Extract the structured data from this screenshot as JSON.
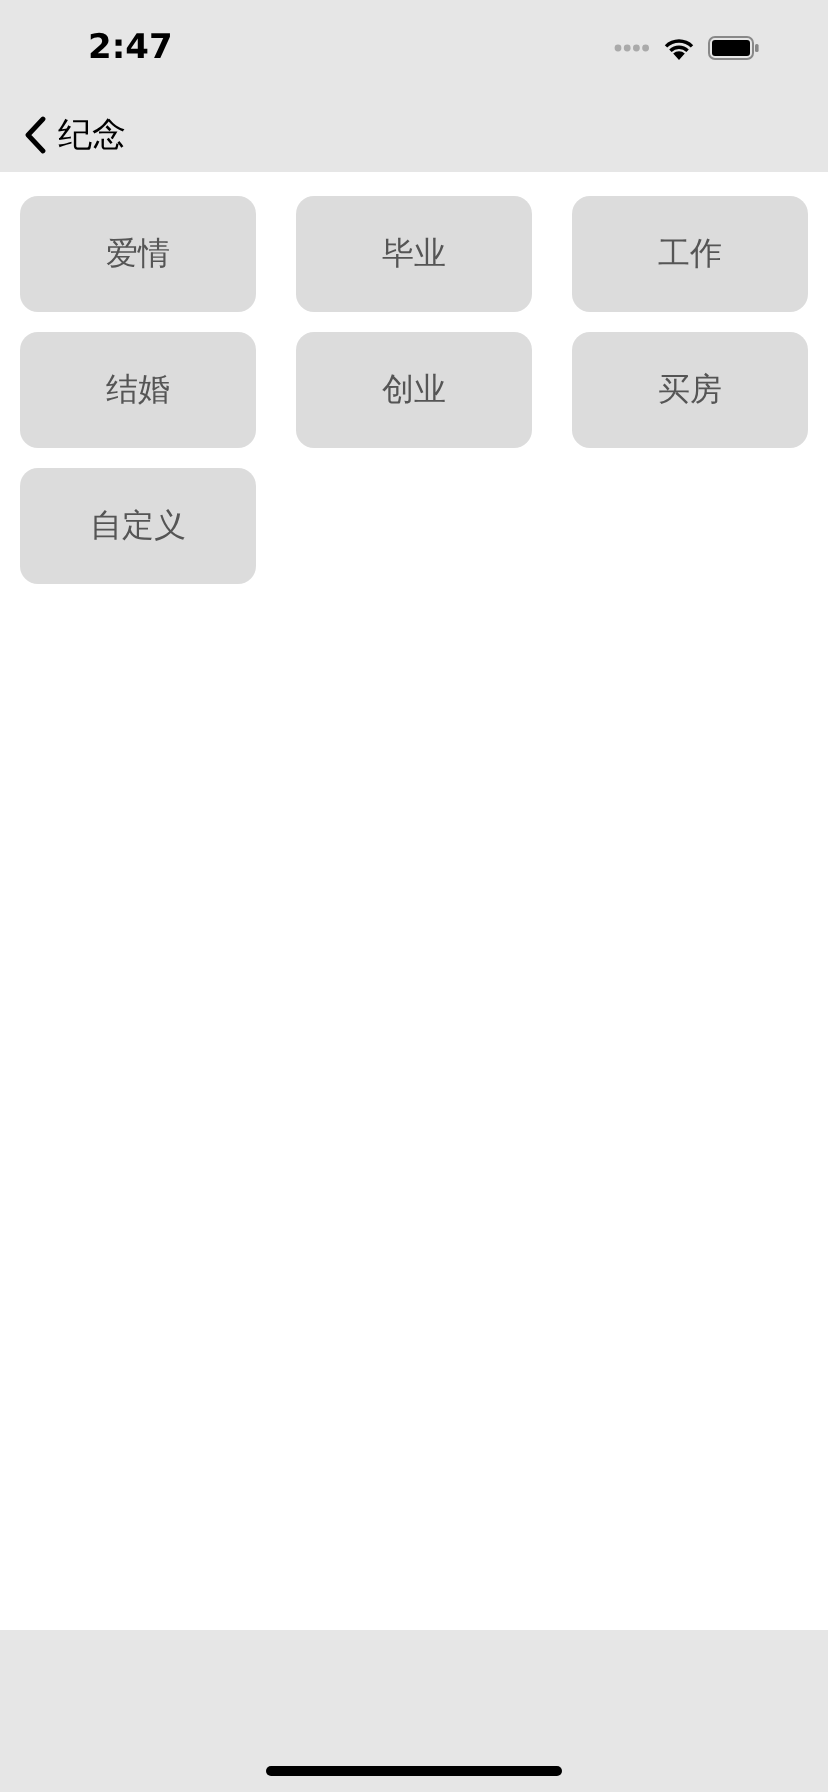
{
  "status_bar": {
    "time": "2:47"
  },
  "nav_bar": {
    "back_label": "纪念"
  },
  "options": [
    {
      "label": "爱情"
    },
    {
      "label": "毕业"
    },
    {
      "label": "工作"
    },
    {
      "label": "结婚"
    },
    {
      "label": "创业"
    },
    {
      "label": "买房"
    },
    {
      "label": "自定义"
    }
  ]
}
